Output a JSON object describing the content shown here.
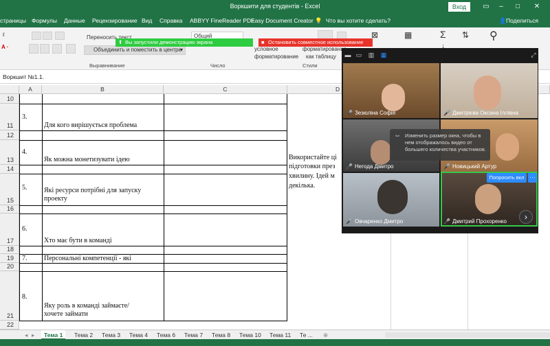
{
  "window": {
    "title": "Воркшити для студентів  -  Excel",
    "signin_label": "Вход"
  },
  "menu": {
    "tabs": [
      "страницы",
      "Формулы",
      "Данные",
      "Рецензирование",
      "Вид",
      "Справка",
      "ABBYY FineReader PDF",
      "Easy Document Creator"
    ],
    "tell_me": "Что вы хотите сделать?",
    "share": "Поделиться"
  },
  "ribbon": {
    "wrap_text": "Переносить текст",
    "merge_center": "Объединить и поместить в центре",
    "number_format": "Общий",
    "conditional": "условное",
    "format_as": "форматирование",
    "as_table": "как таблицу",
    "formatting": "форматирование",
    "group_alignment": "Выравнивание",
    "group_number": "Число",
    "group_styles": "Стили",
    "accent": "#217346"
  },
  "share_banner": {
    "green_text": "Вы запустили демонстрацию экрана",
    "red_text": "Остановить совместное использование"
  },
  "formula_bar": {
    "content": "Воркшит №1.1."
  },
  "grid": {
    "columns": [
      "A",
      "B",
      "C",
      "D"
    ],
    "rows": [
      {
        "num": "10"
      },
      {
        "num": "11"
      },
      {
        "num": "12"
      },
      {
        "num": "13"
      },
      {
        "num": "14"
      },
      {
        "num": "15"
      },
      {
        "num": "16"
      },
      {
        "num": "17"
      },
      {
        "num": "18"
      },
      {
        "num": "19"
      },
      {
        "num": "20"
      },
      {
        "num": "21"
      },
      {
        "num": "22"
      }
    ],
    "cells": {
      "a11": "3.",
      "b11": "Для кого вирішується проблема",
      "a13": "4.",
      "b13": "Як можна монетизувати ідею",
      "a15": "5.",
      "b15": "Які ресурси потрібні для запуску проекту",
      "a17": "6.",
      "b17": "Хто має бути в команді",
      "a19": "7.",
      "b19": "Персональні компетенції - які",
      "a21": "8.",
      "b21": "Яку роль в команді займаєте/хочете займати",
      "d_line1": "Використайте ці",
      "d_line2": "підготовки през",
      "d_line3": "хвилину. Ідей м",
      "d_line4": "декілька."
    }
  },
  "sheets": {
    "tabs": [
      "Тема 1",
      "Тема 2",
      "Тема 3",
      "Тема 4",
      "Тема 6",
      "Тема 7",
      "Тема 8",
      "Тема 10",
      "Тема 11",
      "Те ..."
    ],
    "active": "Тема 1"
  },
  "zoom": {
    "participants": [
      {
        "name": "Зезюліна Софія"
      },
      {
        "name": "Дмитрієва Оксана Іллівна"
      },
      {
        "name": "Негода Дмитро"
      },
      {
        "name": "Новицький Артур"
      },
      {
        "name": "Овчаренко Дмитро"
      },
      {
        "name": "Дмитрий Прохоренко"
      }
    ],
    "tooltip": "Изменить размер окна, чтобы в нем отображалось видео от большего количества участников.",
    "ask_button": "Попросить вкл",
    "more_button": "···"
  }
}
